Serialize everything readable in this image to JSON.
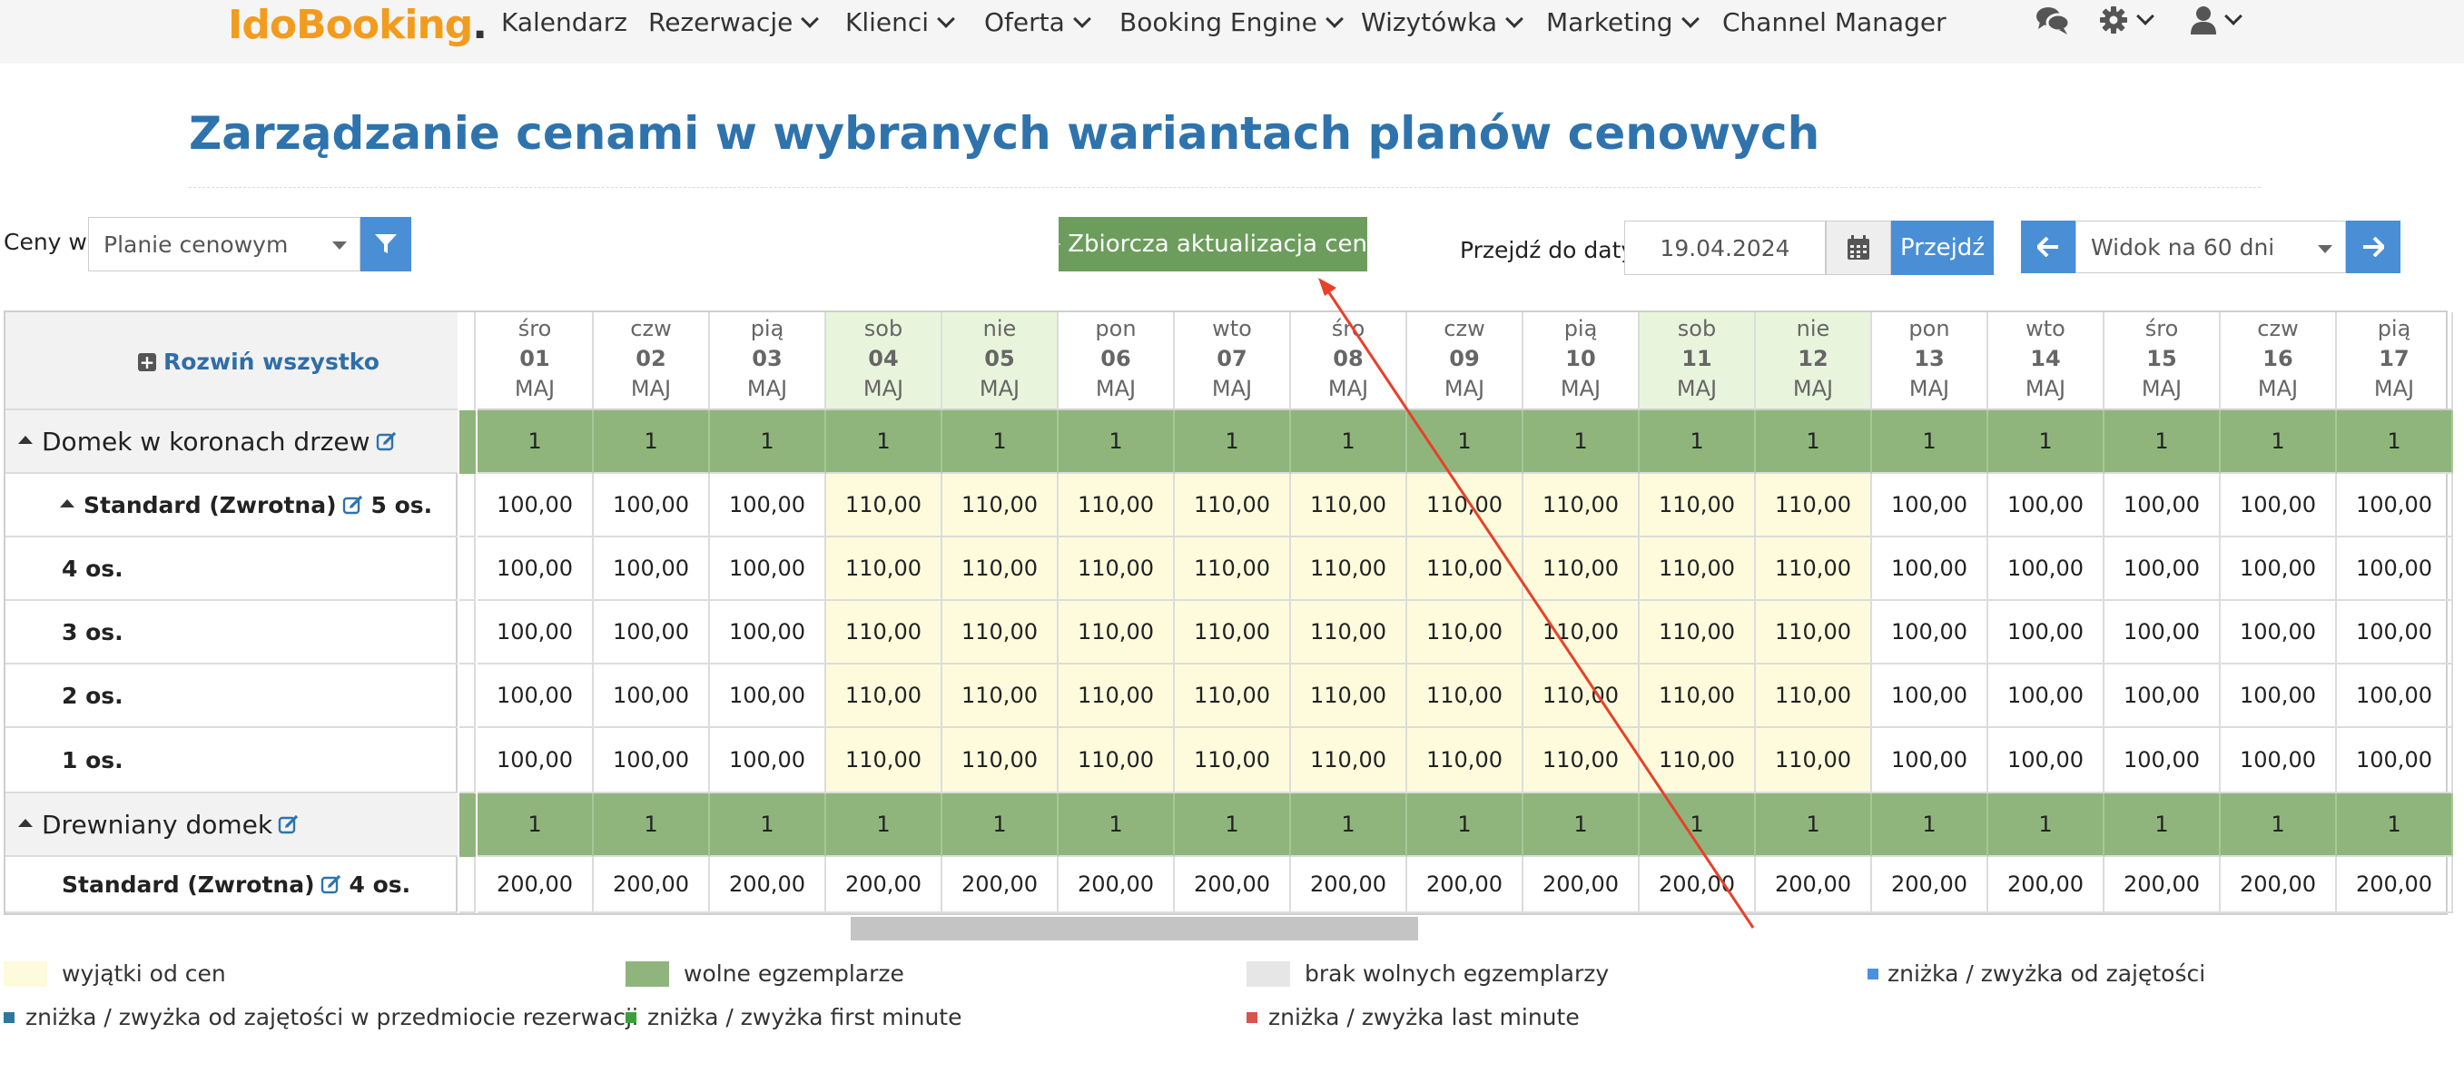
{
  "nav": {
    "logo_part1": "Ido",
    "logo_part2": "Booking",
    "logo_dot": ".",
    "items": [
      {
        "label": "Kalendarz"
      },
      {
        "label": "Rezerwacje"
      },
      {
        "label": "Klienci"
      },
      {
        "label": "Oferta"
      },
      {
        "label": "Booking Engine"
      },
      {
        "label": "Wizytówka"
      },
      {
        "label": "Marketing"
      },
      {
        "label": "Channel Manager"
      }
    ],
    "icons": [
      "chat-icon",
      "gear-icon",
      "user-icon"
    ]
  },
  "page": {
    "title": "Zarządzanie cenami w wybranych wariantach planów cenowych"
  },
  "toolbar": {
    "prices_in_label": "Ceny w",
    "prices_in_value": "Planie cenowym",
    "bulk_update_label": "Zbiorcza aktualizacja cen",
    "goto_date_label": "Przejdź do daty",
    "goto_date_value": "19.04.2024",
    "goto_button": "Przejdź",
    "view_value": "Widok na 60 dni"
  },
  "grid": {
    "expand_all": "Rozwiń wszystko",
    "month": "MAJ",
    "days": [
      {
        "dow": "śro",
        "day": "01",
        "weekend": false
      },
      {
        "dow": "czw",
        "day": "02",
        "weekend": false
      },
      {
        "dow": "pią",
        "day": "03",
        "weekend": false
      },
      {
        "dow": "sob",
        "day": "04",
        "weekend": true
      },
      {
        "dow": "nie",
        "day": "05",
        "weekend": true
      },
      {
        "dow": "pon",
        "day": "06",
        "weekend": false
      },
      {
        "dow": "wto",
        "day": "07",
        "weekend": false
      },
      {
        "dow": "śro",
        "day": "08",
        "weekend": false
      },
      {
        "dow": "czw",
        "day": "09",
        "weekend": false
      },
      {
        "dow": "pią",
        "day": "10",
        "weekend": false
      },
      {
        "dow": "sob",
        "day": "11",
        "weekend": true
      },
      {
        "dow": "nie",
        "day": "12",
        "weekend": true
      },
      {
        "dow": "pon",
        "day": "13",
        "weekend": false
      },
      {
        "dow": "wto",
        "day": "14",
        "weekend": false
      },
      {
        "dow": "śro",
        "day": "15",
        "weekend": false
      },
      {
        "dow": "czw",
        "day": "16",
        "weekend": false
      },
      {
        "dow": "pią",
        "day": "17",
        "weekend": false
      }
    ],
    "rows": [
      {
        "type": "group",
        "label": "Domek w koronach drzew",
        "values": [
          "1",
          "1",
          "1",
          "1",
          "1",
          "1",
          "1",
          "1",
          "1",
          "1",
          "1",
          "1",
          "1",
          "1",
          "1",
          "1",
          "1"
        ]
      },
      {
        "type": "plan",
        "label": "Standard (Zwrotna)",
        "suffix": "5 os.",
        "values": [
          "100,00",
          "100,00",
          "100,00",
          "110,00",
          "110,00",
          "110,00",
          "110,00",
          "110,00",
          "110,00",
          "110,00",
          "110,00",
          "110,00",
          "100,00",
          "100,00",
          "100,00",
          "100,00",
          "100,00"
        ],
        "exception": [
          false,
          false,
          false,
          true,
          true,
          true,
          true,
          true,
          true,
          true,
          true,
          true,
          false,
          false,
          false,
          false,
          false
        ]
      },
      {
        "type": "variant",
        "label": "4 os.",
        "values": [
          "100,00",
          "100,00",
          "100,00",
          "110,00",
          "110,00",
          "110,00",
          "110,00",
          "110,00",
          "110,00",
          "110,00",
          "110,00",
          "110,00",
          "100,00",
          "100,00",
          "100,00",
          "100,00",
          "100,00"
        ],
        "exception": [
          false,
          false,
          false,
          true,
          true,
          true,
          true,
          true,
          true,
          true,
          true,
          true,
          false,
          false,
          false,
          false,
          false
        ]
      },
      {
        "type": "variant",
        "label": "3 os.",
        "values": [
          "100,00",
          "100,00",
          "100,00",
          "110,00",
          "110,00",
          "110,00",
          "110,00",
          "110,00",
          "110,00",
          "110,00",
          "110,00",
          "110,00",
          "100,00",
          "100,00",
          "100,00",
          "100,00",
          "100,00"
        ],
        "exception": [
          false,
          false,
          false,
          true,
          true,
          true,
          true,
          true,
          true,
          true,
          true,
          true,
          false,
          false,
          false,
          false,
          false
        ]
      },
      {
        "type": "variant",
        "label": "2 os.",
        "values": [
          "100,00",
          "100,00",
          "100,00",
          "110,00",
          "110,00",
          "110,00",
          "110,00",
          "110,00",
          "110,00",
          "110,00",
          "110,00",
          "110,00",
          "100,00",
          "100,00",
          "100,00",
          "100,00",
          "100,00"
        ],
        "exception": [
          false,
          false,
          false,
          true,
          true,
          true,
          true,
          true,
          true,
          true,
          true,
          true,
          false,
          false,
          false,
          false,
          false
        ]
      },
      {
        "type": "variant",
        "label": "1 os.",
        "values": [
          "100,00",
          "100,00",
          "100,00",
          "110,00",
          "110,00",
          "110,00",
          "110,00",
          "110,00",
          "110,00",
          "110,00",
          "110,00",
          "110,00",
          "100,00",
          "100,00",
          "100,00",
          "100,00",
          "100,00"
        ],
        "exception": [
          false,
          false,
          false,
          true,
          true,
          true,
          true,
          true,
          true,
          true,
          true,
          true,
          false,
          false,
          false,
          false,
          false
        ]
      },
      {
        "type": "group",
        "label": "Drewniany domek",
        "values": [
          "1",
          "1",
          "1",
          "1",
          "1",
          "1",
          "1",
          "1",
          "1",
          "1",
          "1",
          "1",
          "1",
          "1",
          "1",
          "1",
          "1"
        ]
      },
      {
        "type": "plan-noarrow",
        "label": "Standard (Zwrotna)",
        "suffix": "4 os.",
        "values": [
          "200,00",
          "200,00",
          "200,00",
          "200,00",
          "200,00",
          "200,00",
          "200,00",
          "200,00",
          "200,00",
          "200,00",
          "200,00",
          "200,00",
          "200,00",
          "200,00",
          "200,00",
          "200,00",
          "200,00"
        ],
        "exception": [
          false,
          false,
          false,
          false,
          false,
          false,
          false,
          false,
          false,
          false,
          false,
          false,
          false,
          false,
          false,
          false,
          false
        ]
      }
    ]
  },
  "legend": {
    "items": [
      {
        "label": "wyjątki od cen",
        "color": "#fdfbdc"
      },
      {
        "label": "wolne egzemplarze",
        "color": "#8fb57c"
      },
      {
        "label": "brak wolnych egzemplarzy",
        "color": "#e6e6e6"
      },
      {
        "label": "zniżka / zwyżka od zajętości",
        "color": "#4a90e2"
      },
      {
        "label": "zniżka / zwyżka od zajętości w przedmiocie rezerwacji",
        "color": "#2b7a9e"
      },
      {
        "label": "zniżka / zwyżka first minute",
        "color": "#3aa13a"
      },
      {
        "label": "zniżka / zwyżka last minute",
        "color": "#d9534f"
      }
    ]
  },
  "colors": {
    "accent_blue": "#4a8fd6",
    "title_blue": "#2f73ad",
    "green_button": "#6c9d5c",
    "available_green": "#8fb57c",
    "exception_yellow": "#fdfbdc",
    "weekend_header": "#e8f5dc",
    "annotation_red": "#e8402a"
  }
}
